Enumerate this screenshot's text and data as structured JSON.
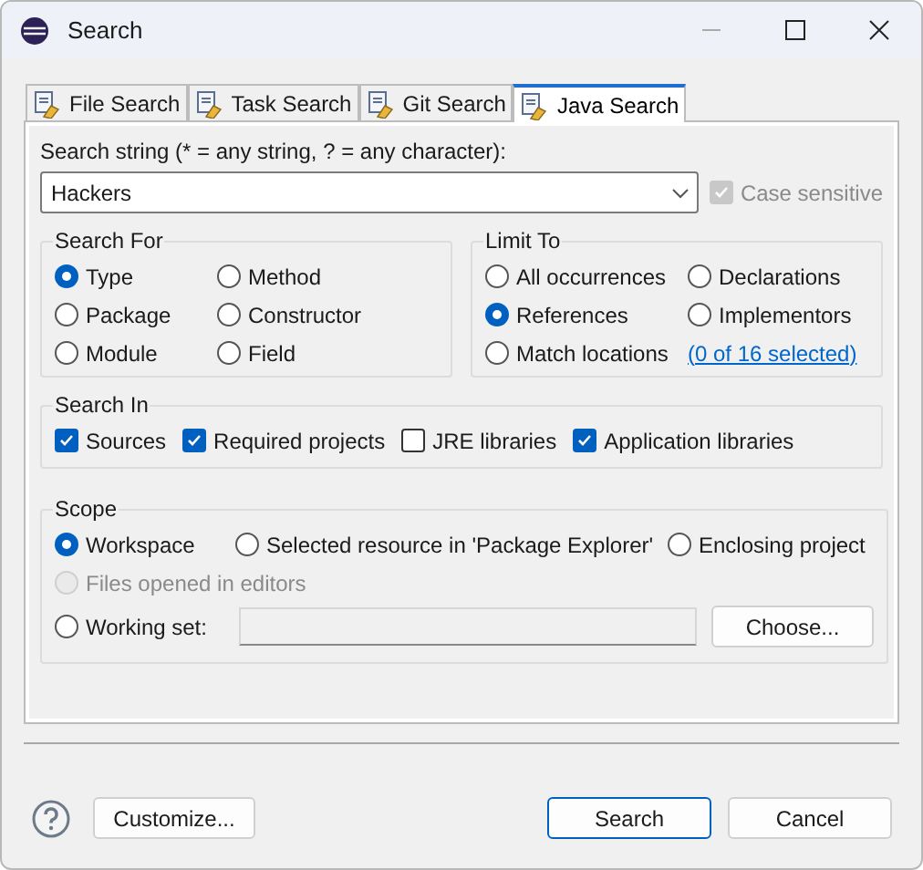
{
  "window": {
    "title": "Search"
  },
  "tabs": [
    {
      "label": "File Search",
      "selected": false
    },
    {
      "label": "Task Search",
      "selected": false
    },
    {
      "label": "Git Search",
      "selected": false
    },
    {
      "label": "Java Search",
      "selected": true
    }
  ],
  "search_string": {
    "label": "Search string (* = any string, ? = any character):",
    "value": "Hackers"
  },
  "case_sensitive": {
    "label": "Case sensitive",
    "checked": true,
    "disabled": true
  },
  "search_for": {
    "title": "Search For",
    "options": [
      {
        "label": "Type",
        "selected": true
      },
      {
        "label": "Method",
        "selected": false
      },
      {
        "label": "Package",
        "selected": false
      },
      {
        "label": "Constructor",
        "selected": false
      },
      {
        "label": "Module",
        "selected": false
      },
      {
        "label": "Field",
        "selected": false
      }
    ]
  },
  "limit_to": {
    "title": "Limit To",
    "options": [
      {
        "label": "All occurrences",
        "selected": false
      },
      {
        "label": "Declarations",
        "selected": false
      },
      {
        "label": "References",
        "selected": true
      },
      {
        "label": "Implementors",
        "selected": false
      },
      {
        "label": "Match locations",
        "selected": false
      }
    ],
    "link": "(0 of 16 selected)"
  },
  "search_in": {
    "title": "Search In",
    "options": [
      {
        "label": "Sources",
        "checked": true
      },
      {
        "label": "Required projects",
        "checked": true
      },
      {
        "label": "JRE libraries",
        "checked": false
      },
      {
        "label": "Application libraries",
        "checked": true
      }
    ]
  },
  "scope": {
    "title": "Scope",
    "options": [
      {
        "label": "Workspace",
        "selected": true,
        "disabled": false
      },
      {
        "label": "Selected resource in 'Package Explorer'",
        "selected": false,
        "disabled": false
      },
      {
        "label": "Enclosing project",
        "selected": false,
        "disabled": false
      },
      {
        "label": "Files opened in editors",
        "selected": false,
        "disabled": true
      }
    ],
    "working_set": {
      "label": "Working set:",
      "selected": false
    },
    "choose_button": "Choose..."
  },
  "buttons": {
    "customize": "Customize...",
    "search": "Search",
    "cancel": "Cancel"
  }
}
